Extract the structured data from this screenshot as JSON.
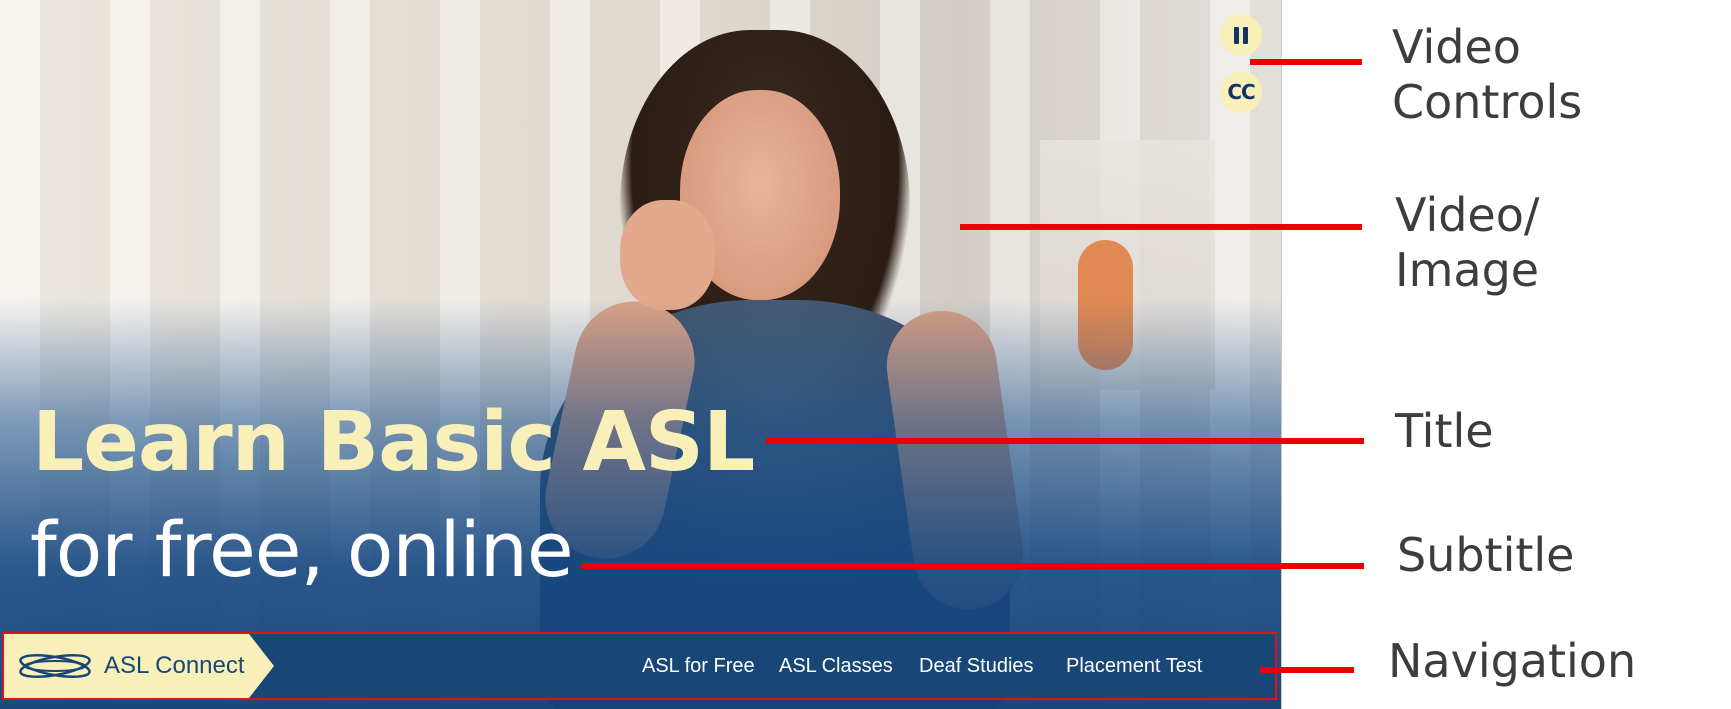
{
  "hero": {
    "title": "Learn Basic ASL",
    "subtitle": "for free, online"
  },
  "video_controls": {
    "pause_icon": "pause-icon",
    "cc_label": "CC"
  },
  "nav": {
    "brand": "ASL Connect",
    "links": [
      "ASL for Free",
      "ASL Classes",
      "Deaf Studies",
      "Placement Test"
    ]
  },
  "annotations": {
    "video_controls": "Video\nControls",
    "video_image": "Video/\nImage",
    "title": "Title",
    "subtitle": "Subtitle",
    "navigation": "Navigation"
  },
  "colors": {
    "accent_yellow": "#f8f0b8",
    "nav_blue": "#174677",
    "annotation_red": "#ef0000"
  }
}
